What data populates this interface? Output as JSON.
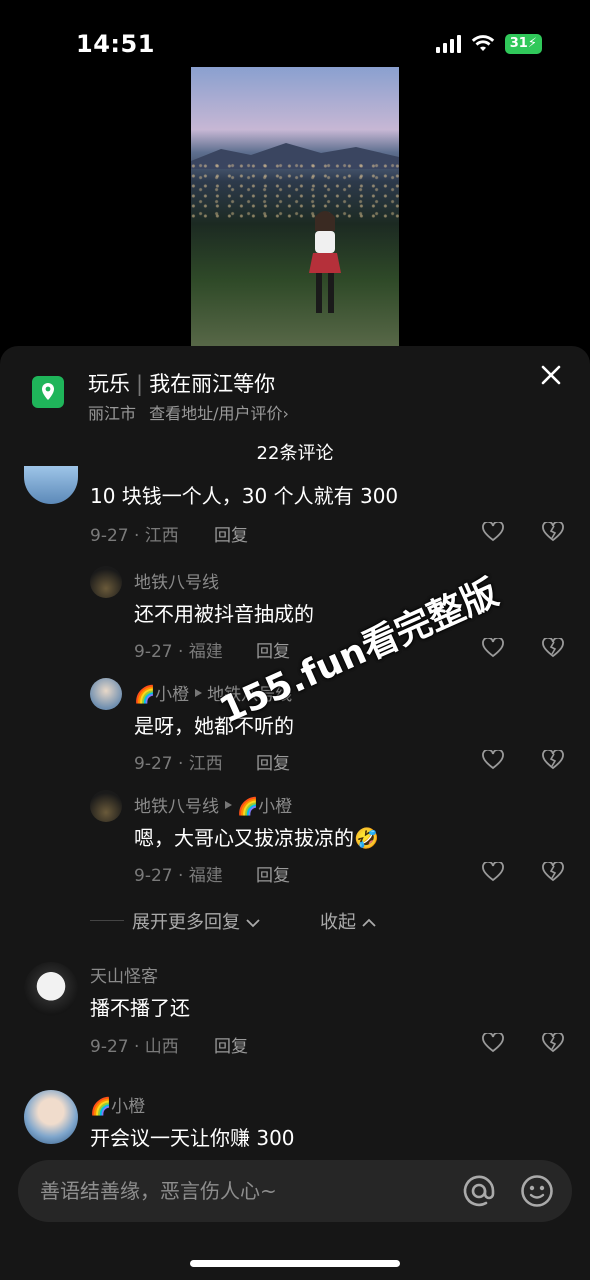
{
  "status": {
    "time": "14:51",
    "battery": "31"
  },
  "location": {
    "category": "玩乐",
    "name": "我在丽江等你",
    "city": "丽江市",
    "link": "查看地址/用户评价",
    "chevron": "›"
  },
  "comment_count": "22条评论",
  "comments": [
    {
      "text": "10 块钱一个人，30 个人就有 300",
      "date": "9-27 · 江西",
      "reply": "回复"
    },
    {
      "user": "地铁八号线",
      "text": "还不用被抖音抽成的",
      "date": "9-27 · 福建",
      "reply": "回复"
    },
    {
      "user": "🌈小橙",
      "reply_to": "地铁八号线",
      "text": "是呀，她都不听的",
      "date": "9-27 · 江西",
      "reply": "回复"
    },
    {
      "user": "地铁八号线",
      "reply_to": "🌈小橙",
      "text": "嗯，大哥心又拔凉拔凉的🤣",
      "date": "9-27 · 福建",
      "reply": "回复"
    },
    {
      "user": "天山怪客",
      "text": "播不播了还",
      "date": "9-27 · 山西",
      "reply": "回复"
    },
    {
      "user": "🌈小橙",
      "text": "开会议一天让你赚 300"
    }
  ],
  "expand": {
    "more": "展开更多回复",
    "collapse": "收起"
  },
  "watermark": "155.fun看完整版",
  "input": {
    "placeholder": "善语结善缘，恶言伤人心~"
  },
  "colors": {
    "sheet": "#161616",
    "pin": "#1fb55a",
    "battery": "#30c85a"
  },
  "icons": [
    "location-pin-icon",
    "close-icon",
    "heart-icon",
    "broken-heart-icon",
    "at-icon",
    "emoji-icon",
    "play-triangle-icon",
    "chevron-down-icon",
    "chevron-up-icon"
  ]
}
